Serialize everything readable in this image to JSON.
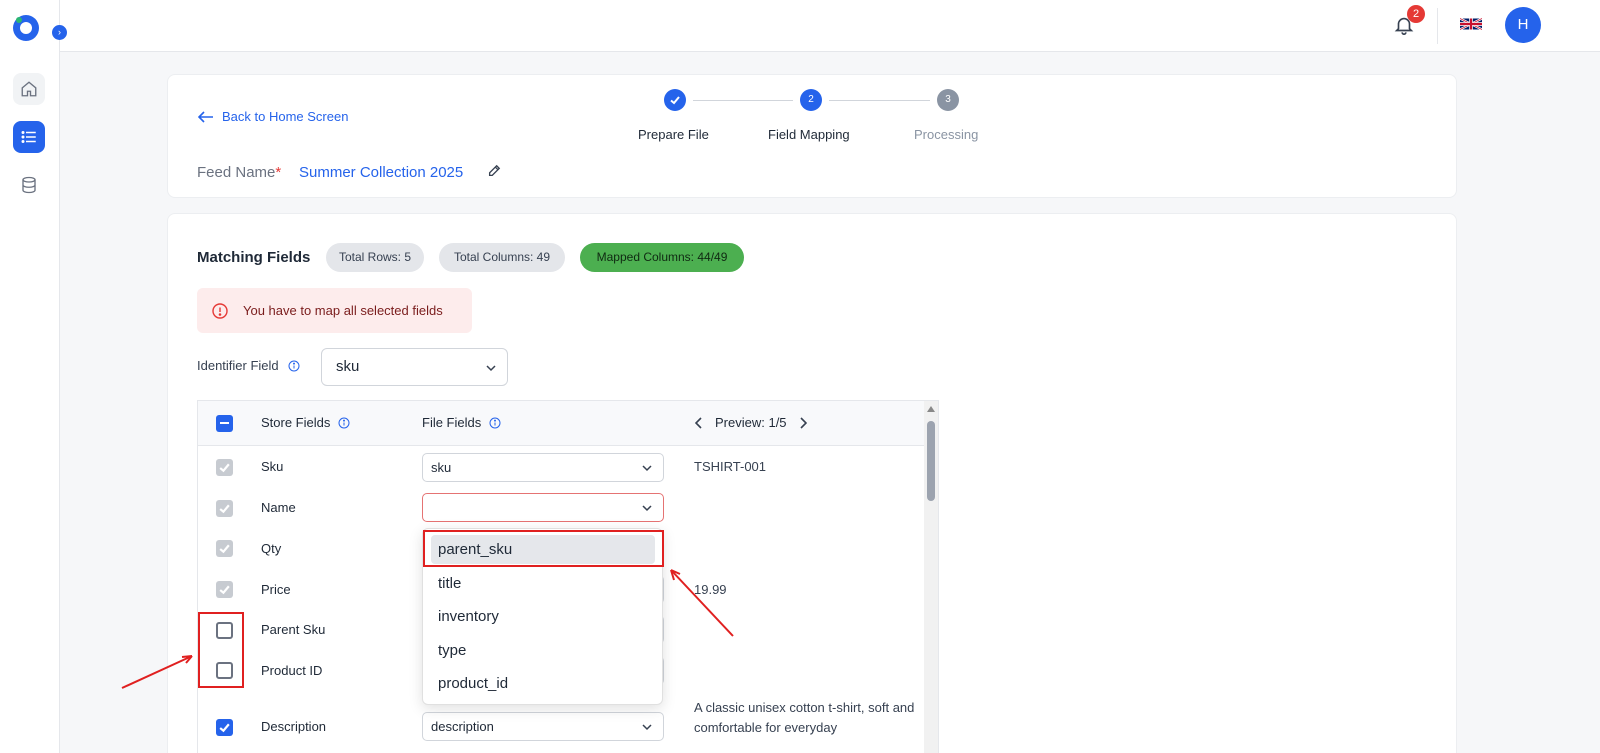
{
  "sidebar": {
    "items": [
      {
        "name": "home",
        "icon": "home-icon"
      },
      {
        "name": "feeds",
        "icon": "list-icon"
      },
      {
        "name": "database",
        "icon": "database-icon"
      }
    ],
    "expand_icon": "›"
  },
  "topbar": {
    "notification_count": "2",
    "language": "en-GB",
    "avatar_initial": "H"
  },
  "header": {
    "back_label": "Back to Home Screen",
    "steps": [
      {
        "number": "✓",
        "label": "Prepare File",
        "status": "done"
      },
      {
        "number": "2",
        "label": "Field Mapping",
        "status": "active"
      },
      {
        "number": "3",
        "label": "Processing",
        "status": "pending"
      }
    ],
    "feed_label": "Feed Name",
    "feed_required": "*",
    "feed_name": "Summer Collection 2025"
  },
  "matching": {
    "title": "Matching Fields",
    "total_rows": "Total Rows: 5",
    "total_columns": "Total Columns: 49",
    "mapped_columns": "Mapped Columns: 44/49",
    "alert": "You have to map all selected fields",
    "identifier_label": "Identifier Field",
    "identifier_value": "sku"
  },
  "table": {
    "headers": {
      "store_fields": "Store Fields",
      "file_fields": "File Fields",
      "preview": "Preview: 1/5"
    },
    "rows": [
      {
        "label": "Sku",
        "file_field": "sku",
        "preview": "TSHIRT-001",
        "checkbox": "checked-disabled"
      },
      {
        "label": "Name",
        "file_field": "",
        "preview": "",
        "checkbox": "checked-disabled"
      },
      {
        "label": "Qty",
        "file_field": "",
        "preview": "",
        "checkbox": "checked-disabled"
      },
      {
        "label": "Price",
        "file_field": "",
        "preview": "19.99",
        "checkbox": "checked-disabled"
      },
      {
        "label": "Parent Sku",
        "file_field": "",
        "preview": "",
        "checkbox": "unchecked"
      },
      {
        "label": "Product ID",
        "file_field": "",
        "preview": "",
        "checkbox": "unchecked"
      },
      {
        "label": "Description",
        "file_field": "description",
        "preview": "A classic unisex cotton t-shirt, soft and comfortable for everyday",
        "checkbox": "checked"
      }
    ]
  },
  "dropdown": {
    "options": [
      "parent_sku",
      "title",
      "inventory",
      "type",
      "product_id"
    ],
    "highlighted": "parent_sku"
  },
  "colors": {
    "accent": "#2563eb",
    "success": "#4caf50",
    "error": "#e53935",
    "annotation": "#e02020"
  }
}
